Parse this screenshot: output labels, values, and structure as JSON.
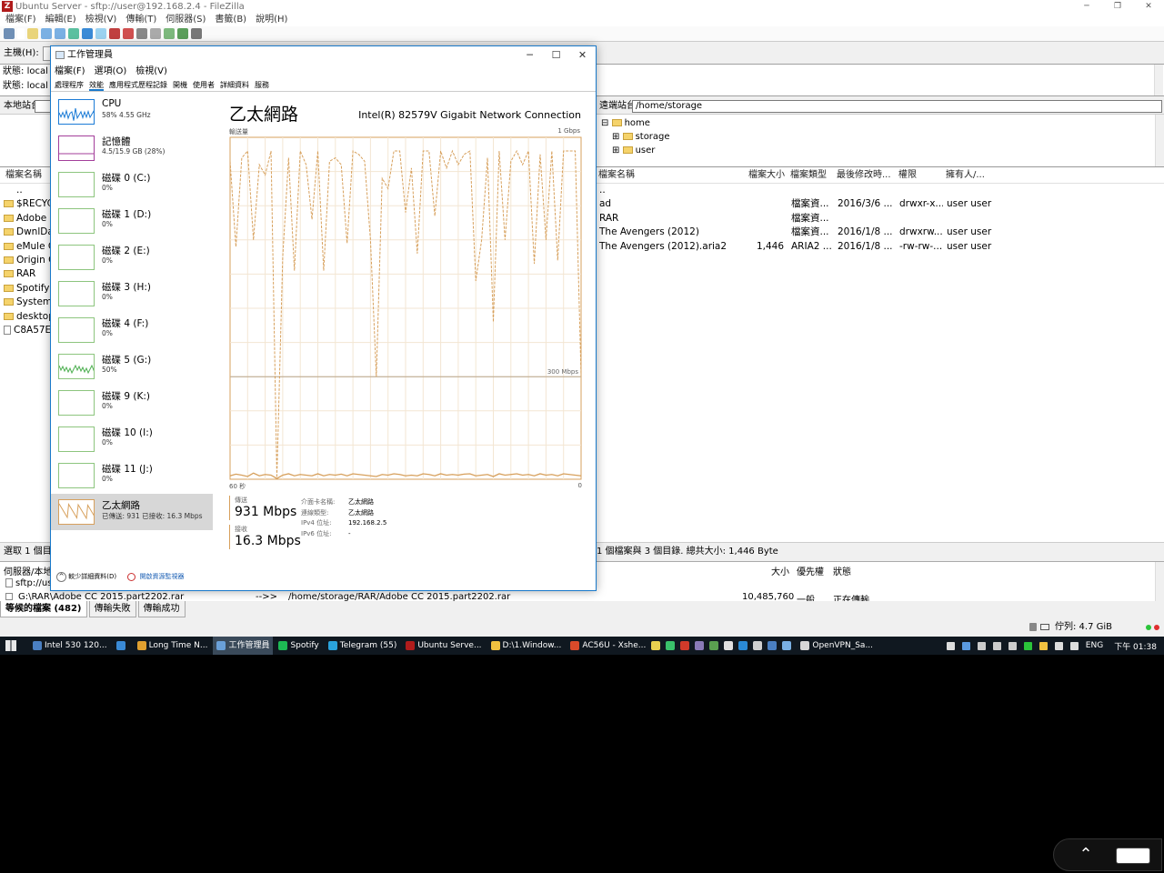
{
  "filezilla": {
    "title": "Ubuntu Server - sftp://user@192.168.2.4 - FileZilla",
    "menu": [
      "檔案(F)",
      "編輯(E)",
      "檢視(V)",
      "傳輸(T)",
      "伺服器(S)",
      "書籤(B)",
      "說明(H)"
    ],
    "host_label": "主機(H):",
    "log_lines": [
      {
        "label": "狀態:",
        "text": "local"
      },
      {
        "label": "狀態:",
        "text": "local"
      }
    ],
    "local_site_label": "本地站台:",
    "remote_site_label": "遠端站台:",
    "remote_path": "/home/storage",
    "remote_tree": [
      "home",
      "storage",
      "user"
    ],
    "local_header": "檔案名稱",
    "local_files": [
      "..",
      "$RECYC",
      "Adobe C",
      "DwnlDat",
      "eMule C",
      "Origin C",
      "RAR",
      "Spotify C",
      "System V",
      "desktop.",
      "C8A57E"
    ],
    "remote_columns": [
      "檔案名稱",
      "檔案大小",
      "檔案類型",
      "最後修改時...",
      "權限",
      "擁有人/..."
    ],
    "remote_files": [
      {
        "name": "..",
        "size": "",
        "type": "",
        "modified": "",
        "perms": "",
        "owner": ""
      },
      {
        "name": "ad",
        "size": "",
        "type": "檔案資...",
        "modified": "2016/3/6 ...",
        "perms": "drwxr-x...",
        "owner": "user user"
      },
      {
        "name": "RAR",
        "size": "",
        "type": "檔案資...",
        "modified": "",
        "perms": "",
        "owner": ""
      },
      {
        "name": "The Avengers (2012)",
        "size": "",
        "type": "檔案資...",
        "modified": "2016/1/8 ...",
        "perms": "drwxrw...",
        "owner": "user user"
      },
      {
        "name": "The Avengers (2012).aria2",
        "size": "1,446",
        "type": "ARIA2 ...",
        "modified": "2016/1/8 ...",
        "perms": "-rw-rw-...",
        "owner": "user user"
      }
    ],
    "local_status": "選取 1 個目",
    "remote_status": "1 個檔案與 3 個目錄. 總共大小: 1,446 Byte",
    "queue_header_left": "伺服器/本地",
    "queue_columns": [
      "大小",
      "優先權",
      "狀態"
    ],
    "queue_rows": [
      {
        "text": "sftp://us"
      },
      {
        "text": "G:\\RAR\\Adobe CC 2015.part2202.rar",
        "arrow": "-->>",
        "remote": "/home/storage/RAR/Adobe CC 2015.part2202.rar",
        "size": "10,485,760",
        "priority": "一般",
        "status": "正在傳輸"
      }
    ],
    "queue_tabs": [
      "等候的檔案 (482)",
      "傳輸失敗",
      "傳輸成功"
    ],
    "bottom_status": "佇列: 4.7 GiB"
  },
  "taskmgr": {
    "title": "工作管理員",
    "menu": [
      "檔案(F)",
      "選項(O)",
      "檢視(V)"
    ],
    "tabs": [
      "處理程序",
      "效能",
      "應用程式歷程記錄",
      "開機",
      "使用者",
      "詳細資料",
      "服務"
    ],
    "sidebar": [
      {
        "name": "CPU",
        "value": "58%  4.55 GHz",
        "kind": "cpu"
      },
      {
        "name": "記憶體",
        "value": "4.5/15.9 GB (28%)",
        "kind": "mem"
      },
      {
        "name": "磁碟 0 (C:)",
        "value": "0%",
        "kind": "disk"
      },
      {
        "name": "磁碟 1 (D:)",
        "value": "0%",
        "kind": "disk"
      },
      {
        "name": "磁碟 2 (E:)",
        "value": "0%",
        "kind": "disk"
      },
      {
        "name": "磁碟 3 (H:)",
        "value": "0%",
        "kind": "disk"
      },
      {
        "name": "磁碟 4 (F:)",
        "value": "0%",
        "kind": "disk"
      },
      {
        "name": "磁碟 5 (G:)",
        "value": "50%",
        "kind": "disk5"
      },
      {
        "name": "磁碟 9 (K:)",
        "value": "0%",
        "kind": "disk"
      },
      {
        "name": "磁碟 10 (I:)",
        "value": "0%",
        "kind": "disk"
      },
      {
        "name": "磁碟 11 (J:)",
        "value": "0%",
        "kind": "disk"
      },
      {
        "name": "乙太網路",
        "value": "已傳送: 931 已接收: 16.3 Mbps",
        "kind": "eth"
      }
    ],
    "main": {
      "title": "乙太網路",
      "adapter": "Intel(R) 82579V Gigabit Network Connection",
      "throughput_label": "輸送量",
      "max_label": "1 Gbps",
      "mid_label": "300 Mbps",
      "time_label": "60 秒",
      "zero_label": "0",
      "send_label": "傳送",
      "send_value": "931 Mbps",
      "recv_label": "接收",
      "recv_value": "16.3 Mbps",
      "details": [
        {
          "k": "介面卡名稱:",
          "v": "乙太網路"
        },
        {
          "k": "連線類型:",
          "v": "乙太網路"
        },
        {
          "k": "IPv4 位址:",
          "v": "192.168.2.5"
        },
        {
          "k": "IPv6 位址:",
          "v": "-"
        }
      ]
    },
    "footer_less": "較少詳細資料(D)",
    "footer_link": "開啟資源監視器"
  },
  "chart_data": {
    "type": "line",
    "title": "",
    "xlabel": "",
    "ylabel": "",
    "x_range_seconds": [
      60,
      0
    ],
    "ylim_mbps": [
      0,
      1000
    ],
    "series": [
      {
        "name": "傳送",
        "values": [
          930,
          680,
          940,
          960,
          700,
          920,
          890,
          960,
          5,
          650,
          940,
          610,
          960,
          920,
          760,
          960,
          610,
          930,
          940,
          920,
          690,
          960,
          950,
          930,
          700,
          300,
          880,
          850,
          960,
          960,
          780,
          910,
          660,
          960,
          960,
          770,
          960,
          910,
          960,
          920,
          950,
          960,
          580,
          700,
          940,
          460,
          960,
          700,
          930,
          960,
          920,
          960,
          630,
          950,
          700,
          960,
          640,
          960,
          960,
          960,
          300
        ]
      },
      {
        "name": "接收",
        "values": [
          10,
          15,
          12,
          8,
          18,
          10,
          14,
          12,
          2,
          12,
          16,
          10,
          14,
          12,
          10,
          16,
          10,
          14,
          12,
          15,
          10,
          16,
          14,
          12,
          10,
          8,
          14,
          12,
          16,
          14,
          10,
          12,
          10,
          16,
          14,
          10,
          16,
          12,
          14,
          12,
          15,
          16,
          10,
          12,
          14,
          8,
          16,
          12,
          14,
          16,
          12,
          14,
          10,
          16,
          12,
          14,
          10,
          16,
          14,
          12,
          10
        ]
      }
    ]
  },
  "taskbar": {
    "apps": [
      {
        "label": "Intel 530 120...",
        "color": "#4a7fc1"
      },
      {
        "label": "",
        "color": "#3a8ad6"
      },
      {
        "label": "Long Time N...",
        "color": "#e0a030"
      },
      {
        "label": "工作管理員",
        "color": "#6aa0d8"
      },
      {
        "label": "Spotify",
        "color": "#1db954"
      },
      {
        "label": "Telegram (55)",
        "color": "#2aa3dd"
      },
      {
        "label": "Ubuntu Serve...",
        "color": "#b01c1c"
      },
      {
        "label": "D:\\1.Window...",
        "color": "#f0c040"
      },
      {
        "label": "AC56U - Xshe...",
        "color": "#d94a2a"
      }
    ],
    "tray_app": "OpenVPN_Sa...",
    "lang": "ENG",
    "time": "下午 01:38"
  }
}
